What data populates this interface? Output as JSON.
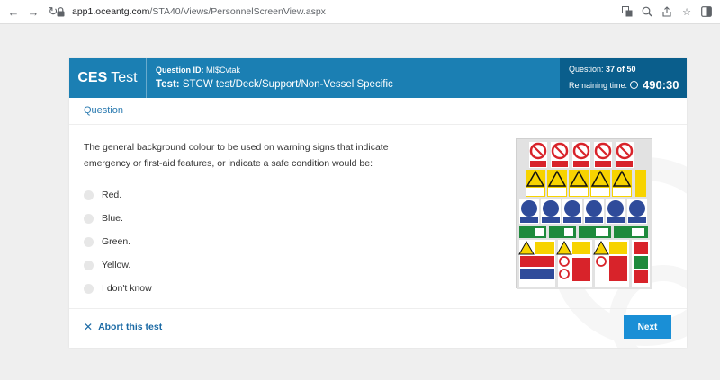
{
  "browser": {
    "url_host": "app1.oceantg.com",
    "url_path": "/STA40/Views/PersonnelScreenView.aspx"
  },
  "header": {
    "brand_bold": "CES",
    "brand_rest": "Test",
    "question_id_label": "Question ID:",
    "question_id": "MI$Cvtak",
    "test_label": "Test:",
    "test_name": "STCW test/Deck/Support/Non-Vessel Specific",
    "question_label": "Question:",
    "question_progress": "37 of 50",
    "remaining_label": "Remaining time:",
    "remaining_time": "490:30"
  },
  "section": {
    "title": "Question"
  },
  "question": {
    "line1": "The general background colour to be used on warning signs that indicate",
    "line2": "emergency or first-aid features, or indicate a safe condition would be:"
  },
  "answers": [
    {
      "label": "Red."
    },
    {
      "label": "Blue."
    },
    {
      "label": "Green."
    },
    {
      "label": "Yellow."
    },
    {
      "label": "I don't know"
    }
  ],
  "footer": {
    "abort_label": "Abort this test",
    "next_label": "Next"
  },
  "colors": {
    "header_blue": "#1b7fb3",
    "header_dark": "#0a5e8c",
    "next_button": "#1a8fd6",
    "link_blue": "#1b6aa5"
  }
}
